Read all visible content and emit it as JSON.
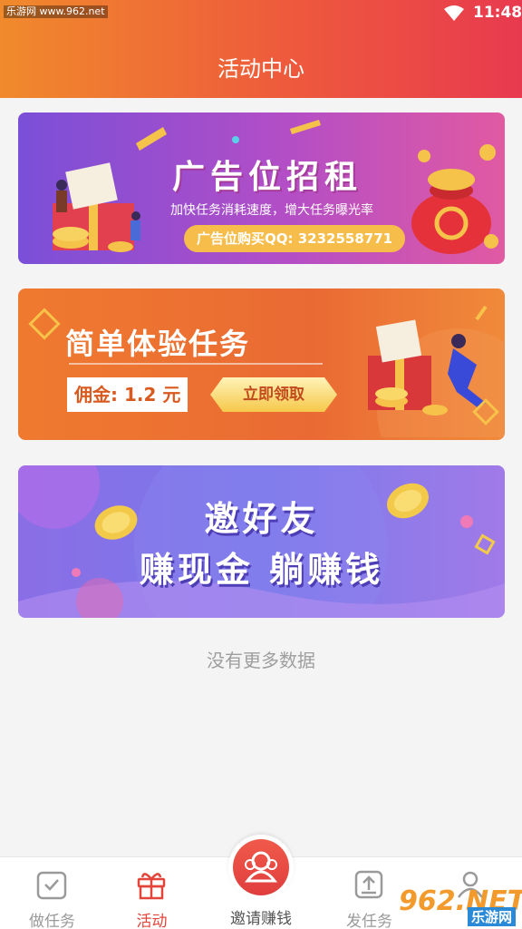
{
  "status_bar": {
    "watermark": "乐游网 www.962.net",
    "time": "11:48"
  },
  "header": {
    "title": "活动中心"
  },
  "banners": {
    "ad": {
      "title": "广告位招租",
      "subtitle": "加快任务消耗速度，增大任务曝光率",
      "contact": "广告位购买QQ: 3232558771"
    },
    "task": {
      "title": "简单体验任务",
      "commission": "佣金: 1.2 元",
      "button_label": "立即领取"
    },
    "invite": {
      "line1": "邀好友",
      "line2": "赚现金 躺赚钱"
    }
  },
  "list_footer": {
    "text": "没有更多数据"
  },
  "tabbar": {
    "tabs": [
      {
        "label": "做任务",
        "icon": "clipboard-check-icon",
        "active": false
      },
      {
        "label": "活动",
        "icon": "gift-icon",
        "active": true
      },
      {
        "label": "邀请赚钱",
        "icon": "users-icon",
        "active": false
      },
      {
        "label": "发任务",
        "icon": "upload-doc-icon",
        "active": false
      },
      {
        "label": "",
        "icon": "user-icon",
        "active": false
      }
    ]
  },
  "watermark_bottom": {
    "brand": "962.NET",
    "site": "乐游网"
  },
  "colors": {
    "accent": "#e3453a",
    "header_start": "#f08a2c",
    "header_end": "#e83a4f",
    "inactive_tab": "#9a9a9a"
  }
}
